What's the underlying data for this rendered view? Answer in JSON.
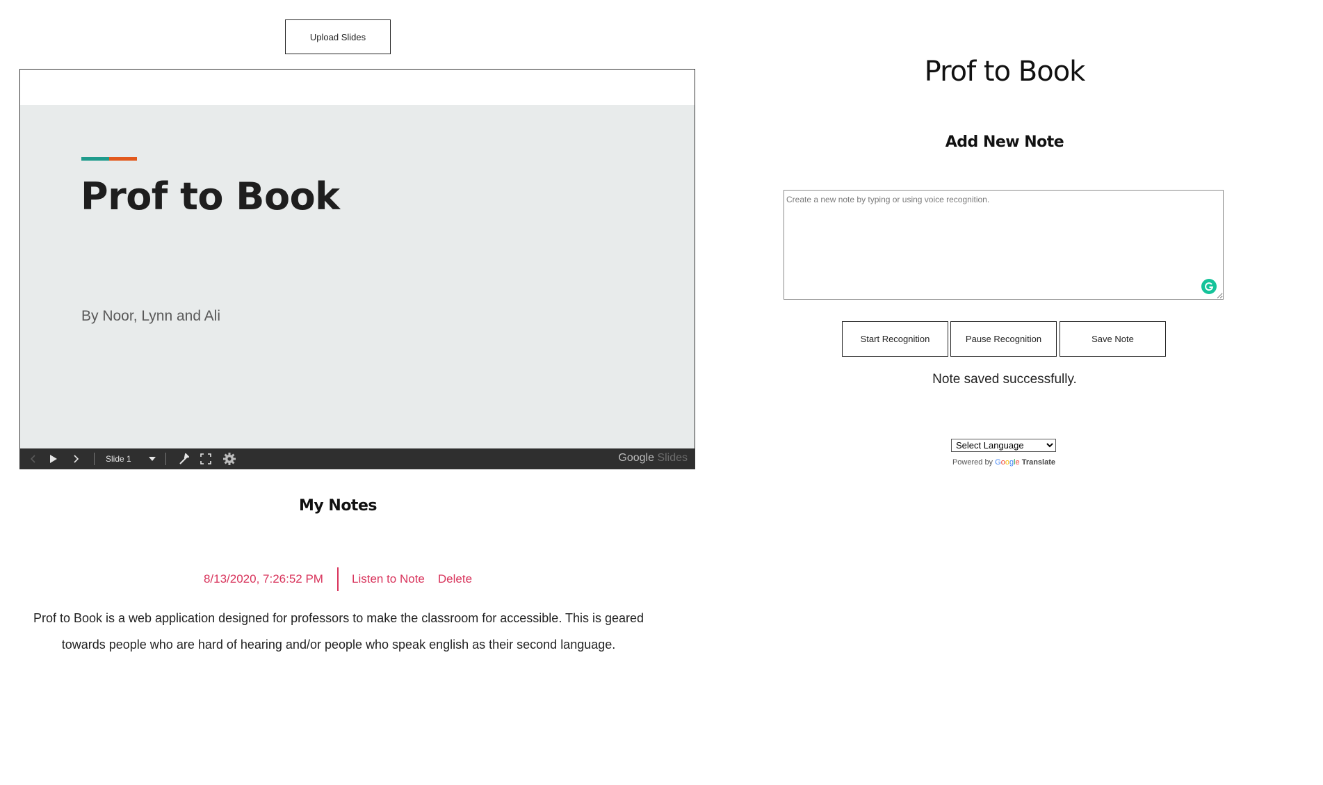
{
  "left": {
    "upload_label": "Upload Slides",
    "slide": {
      "title": "Prof to Book",
      "subtitle": "By Noor, Lynn and Ali",
      "accent_colors": [
        "#1f9b8c",
        "#e2591d"
      ]
    },
    "slides_toolbar": {
      "current_slide": "Slide 1",
      "brand_google": "Google",
      "brand_product": "Slides"
    },
    "notes_heading": "My Notes",
    "notes": [
      {
        "date": "8/13/2020, 7:26:52 PM",
        "listen_label": "Listen to Note",
        "delete_label": "Delete",
        "body": "Prof to Book is a web application designed for professors to make the classroom for accessible. This is geared towards people who are hard of hearing and/or people who speak english as their second language."
      }
    ]
  },
  "right": {
    "app_title": "Prof to Book",
    "add_note_heading": "Add New Note",
    "note_input": {
      "value": "",
      "placeholder": "Create a new note by typing or using voice recognition."
    },
    "buttons": {
      "start": "Start Recognition",
      "pause": "Pause Recognition",
      "save": "Save Note"
    },
    "status": "Note saved successfully.",
    "translate": {
      "selected_language": "Select Language",
      "powered_by": "Powered by",
      "google": "Google",
      "translate_label": "Translate"
    }
  },
  "colors": {
    "note_accent": "#d8335b",
    "grammarly": "#15c39a",
    "slide_background": "#e8ebeb",
    "toolbar_background": "#2f2f2f"
  }
}
